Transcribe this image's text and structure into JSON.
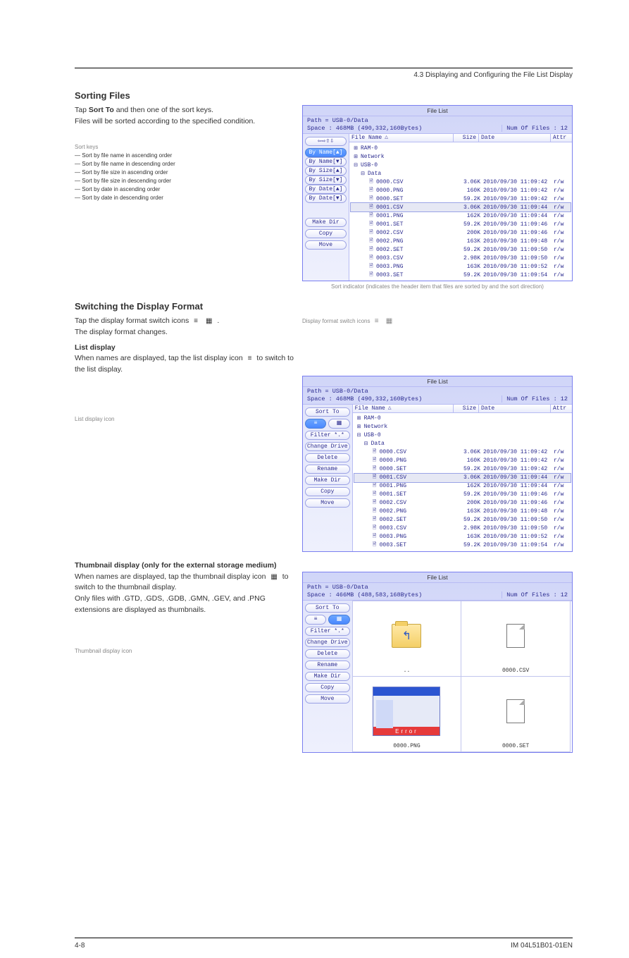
{
  "page_meta": {
    "section_head": "4.3 Displaying and Configuring the File List Display",
    "footer_left": "4-8",
    "footer_right": "IM 04L51B01-01EN"
  },
  "intro": {
    "h1": "Sorting Files",
    "p1_a": "Tap ",
    "p1_b": "Sort To",
    "p1_c": " and then one of the sort keys.",
    "p2": "Files will be sorted according to the specified condition.",
    "key_label_head": "Sort keys",
    "sort_keys_desc": [
      {
        "k": "By Name[▲]",
        "d": "Sort by file name in ascending order"
      },
      {
        "k": "By Name[▼]",
        "d": "Sort by file name in descending order"
      },
      {
        "k": "By Size[▲]",
        "d": "Sort by file size in ascending order"
      },
      {
        "k": "By Size[▼]",
        "d": "Sort by file size in descending order"
      },
      {
        "k": "By Date[▲]",
        "d": "Sort by date in ascending order"
      },
      {
        "k": "By Date[▼]",
        "d": "Sort by date in descending order"
      }
    ],
    "sort_caption": "Sort indicator (indicates the header item that files are sorted by and the sort direction)"
  },
  "midblock": {
    "h1": "Switching the Display Format",
    "line1a": "Tap the display format switch icons",
    "line1b": ".",
    "line2": "The display format changes.",
    "list_head": "List display",
    "note1_a": "When names are displayed, tap the list display icon",
    "note1_b": "to switch to the list display.",
    "grid_head": "Thumbnail display (only for the external storage medium)",
    "note2_a": "When names are displayed, tap the thumbnail display icon",
    "note2_b": "to switch to the thumbnail display.",
    "note3": "Only files with .GTD, .GDS, .GDB, .GMN, .GEV, and .PNG extensions are displayed as thumbnails.",
    "caption_listbtn": "List display icon",
    "caption_thumbbtn": "Thumbnail display icon",
    "caption_switch": "Display format switch icons"
  },
  "panel_shared": {
    "title": "File List",
    "path": "Path = USB-0/Data",
    "space_list": "Space : 468MB (490,332,160Bytes)",
    "space_thumb": "Space : 466MB (488,583,168Bytes)",
    "numfiles": "Num Of Files : 12",
    "headers": {
      "name": "File Name",
      "size": "Size",
      "date": "Date",
      "attr": "Attr"
    },
    "tree_top": [
      "RAM-0",
      "Network",
      "USB-0"
    ],
    "folder": "Data",
    "files": [
      {
        "name": "0000.CSV",
        "size": "3.06K",
        "date": "2010/09/30 11:09:42",
        "attr": "r/w"
      },
      {
        "name": "0000.PNG",
        "size": "160K",
        "date": "2010/09/30 11:09:42",
        "attr": "r/w"
      },
      {
        "name": "0000.SET",
        "size": "59.2K",
        "date": "2010/09/30 11:09:42",
        "attr": "r/w"
      },
      {
        "name": "0001.CSV",
        "size": "3.06K",
        "date": "2010/09/30 11:09:44",
        "attr": "r/w"
      },
      {
        "name": "0001.PNG",
        "size": "162K",
        "date": "2010/09/30 11:09:44",
        "attr": "r/w"
      },
      {
        "name": "0001.SET",
        "size": "59.2K",
        "date": "2010/09/30 11:09:46",
        "attr": "r/w"
      },
      {
        "name": "0002.CSV",
        "size": "200K",
        "date": "2010/09/30 11:09:46",
        "attr": "r/w"
      },
      {
        "name": "0002.PNG",
        "size": "163K",
        "date": "2010/09/30 11:09:48",
        "attr": "r/w"
      },
      {
        "name": "0002.SET",
        "size": "59.2K",
        "date": "2010/09/30 11:09:50",
        "attr": "r/w"
      },
      {
        "name": "0003.CSV",
        "size": "2.98K",
        "date": "2010/09/30 11:09:50",
        "attr": "r/w"
      },
      {
        "name": "0003.PNG",
        "size": "163K",
        "date": "2010/09/30 11:09:52",
        "attr": "r/w"
      },
      {
        "name": "0003.SET",
        "size": "59.2K",
        "date": "2010/09/30 11:09:54",
        "attr": "r/w"
      }
    ],
    "sortbuttons": [
      "By Name[▲]",
      "By Name[▼]",
      "By Size[▲]",
      "By Size[▼]",
      "By Date[▲]",
      "By Date[▼]"
    ],
    "opbuttons": [
      "Make Dir",
      "Copy",
      "Move"
    ],
    "fullbuttons": [
      "Sort To",
      "LISTGRID",
      "Filter *.*",
      "Change Drive",
      "Delete",
      "Rename",
      "Make Dir",
      "Copy",
      "Move"
    ],
    "backcmd": "⇦⇧⇨⇩"
  },
  "thumbs": {
    "up": "..",
    "f1": "0000.CSV",
    "f2": "0000.PNG",
    "f3": "0000.SET",
    "err": "Error"
  }
}
